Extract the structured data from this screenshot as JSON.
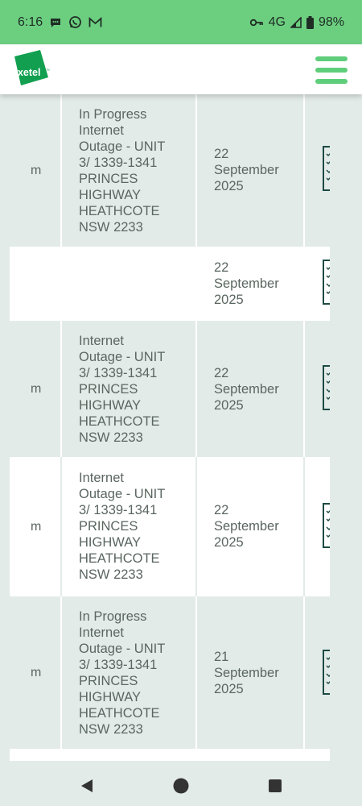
{
  "status_bar": {
    "time": "6:16",
    "network": "4G",
    "battery": "98%"
  },
  "header": {
    "logo_text": "exetel",
    "logo_tm": "™"
  },
  "rows": [
    {
      "email_fragment": "m",
      "issue": [
        "In Progress",
        "Internet",
        "Outage - UNIT",
        "3/ 1339-1341",
        "PRINCES",
        "HIGHWAY",
        "HEATHCOTE",
        "NSW 2233"
      ],
      "date": [
        "22",
        "September",
        "2025"
      ]
    },
    {
      "email_fragment": "",
      "issue": [],
      "date": [
        "22",
        "September",
        "2025"
      ]
    },
    {
      "email_fragment": "m",
      "issue": [
        "Internet",
        "Outage - UNIT",
        "3/ 1339-1341",
        "PRINCES",
        "HIGHWAY",
        "HEATHCOTE",
        "NSW 2233"
      ],
      "date": [
        "22",
        "September",
        "2025"
      ]
    },
    {
      "email_fragment": "m",
      "issue": [
        "Internet",
        "Outage - UNIT",
        "3/ 1339-1341",
        "PRINCES",
        "HIGHWAY",
        "HEATHCOTE",
        "NSW 2233"
      ],
      "date": [
        "22",
        "September",
        "2025"
      ]
    },
    {
      "email_fragment": "m",
      "issue": [
        "In Progress",
        "Internet",
        "Outage - UNIT",
        "3/ 1339-1341",
        "PRINCES",
        "HIGHWAY",
        "HEATHCOTE",
        "NSW 2233"
      ],
      "date": [
        "21",
        "September",
        "2025"
      ]
    }
  ],
  "colors": {
    "brand_green": "#6ccf80",
    "logo_green": "#12a050",
    "row_shade": "#e3ebe9",
    "action_icon": "#1c4a44"
  }
}
